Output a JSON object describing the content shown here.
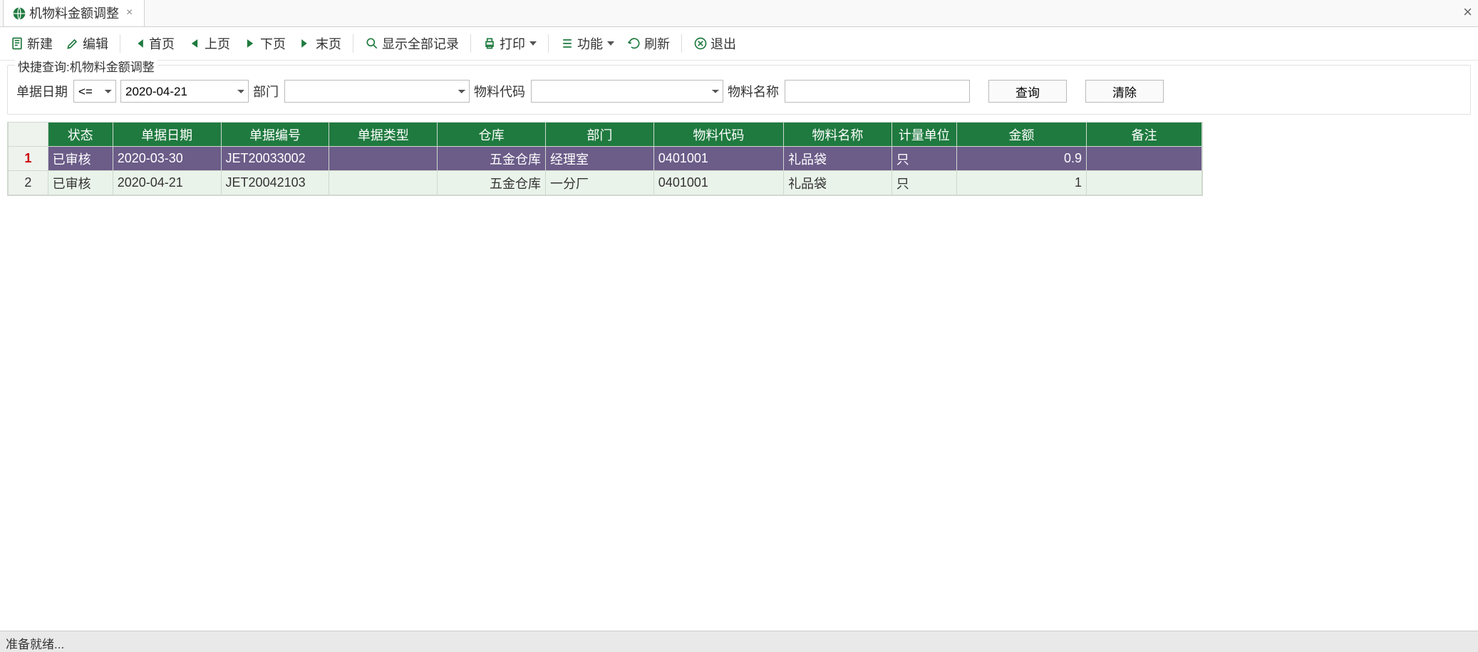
{
  "tab": {
    "title": "机物料金额调整"
  },
  "toolbar": {
    "new": "新建",
    "edit": "编辑",
    "first": "首页",
    "prev": "上页",
    "next": "下页",
    "last": "末页",
    "showall": "显示全部记录",
    "print": "打印",
    "func": "功能",
    "refresh": "刷新",
    "exit": "退出"
  },
  "quick": {
    "legend": "快捷查询:机物料金额调整",
    "labels": {
      "date": "单据日期",
      "dept": "部门",
      "mcode": "物料代码",
      "mname": "物料名称"
    },
    "operator": "<=",
    "date_value": "2020-04-21",
    "dept_value": "",
    "mcode_value": "",
    "mname_value": "",
    "buttons": {
      "search": "查询",
      "clear": "清除"
    }
  },
  "table": {
    "headers": {
      "rownum": "",
      "status": "状态",
      "date": "单据日期",
      "docno": "单据编号",
      "doctype": "单据类型",
      "warehouse": "仓库",
      "dept": "部门",
      "mcode": "物料代码",
      "mname": "物料名称",
      "uom": "计量单位",
      "amount": "金额",
      "remark": "备注"
    },
    "rows": [
      {
        "n": "1",
        "status": "已审核",
        "date": "2020-03-30",
        "docno": "JET20033002",
        "doctype": "",
        "warehouse": "五金仓库",
        "dept": "经理室",
        "mcode": "0401001",
        "mname": "礼品袋",
        "uom": "只",
        "amount": "0.9",
        "remark": "",
        "selected": true
      },
      {
        "n": "2",
        "status": "已审核",
        "date": "2020-04-21",
        "docno": "JET20042103",
        "doctype": "",
        "warehouse": "五金仓库",
        "dept": "一分厂",
        "mcode": "0401001",
        "mname": "礼品袋",
        "uom": "只",
        "amount": "1",
        "remark": "",
        "selected": false
      }
    ]
  },
  "status": "准备就绪..."
}
